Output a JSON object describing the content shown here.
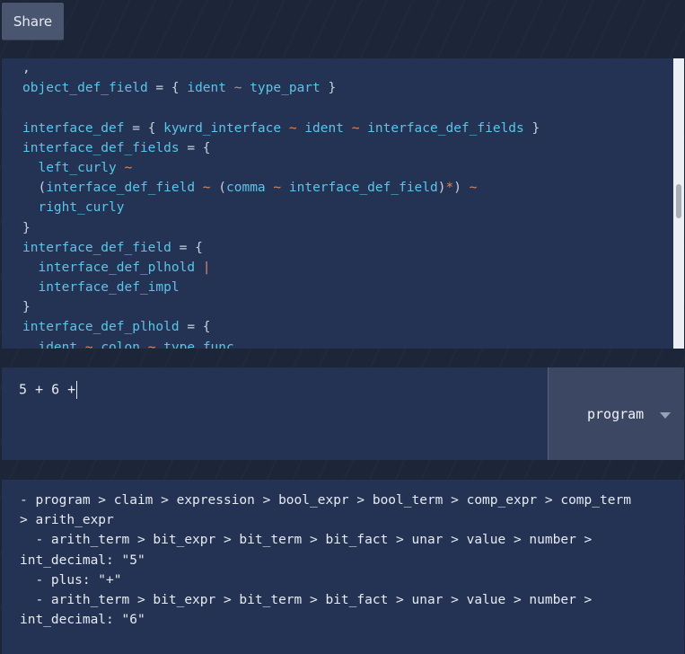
{
  "toolbar": {
    "share_label": "Share"
  },
  "editor": {
    "lines": [
      [
        {
          "t": ",",
          "c": "op"
        }
      ],
      [
        {
          "t": "object_def_field",
          "c": "id"
        },
        {
          "t": " = { ",
          "c": "op"
        },
        {
          "t": "ident",
          "c": "id"
        },
        {
          "t": " ~ ",
          "c": "op2"
        },
        {
          "t": "type_part",
          "c": "id"
        },
        {
          "t": " }",
          "c": "op"
        }
      ],
      [],
      [
        {
          "t": "interface_def",
          "c": "id"
        },
        {
          "t": " = { ",
          "c": "op"
        },
        {
          "t": "kywrd_interface",
          "c": "id"
        },
        {
          "t": " ~ ",
          "c": "op2"
        },
        {
          "t": "ident",
          "c": "id"
        },
        {
          "t": " ~ ",
          "c": "op2"
        },
        {
          "t": "interface_def_fields",
          "c": "id"
        },
        {
          "t": " }",
          "c": "op"
        }
      ],
      [
        {
          "t": "interface_def_fields",
          "c": "id"
        },
        {
          "t": " = {",
          "c": "op"
        }
      ],
      [
        {
          "t": "  left_curly",
          "c": "id"
        },
        {
          "t": " ~",
          "c": "op2"
        }
      ],
      [
        {
          "t": "  (",
          "c": "op"
        },
        {
          "t": "interface_def_field",
          "c": "id"
        },
        {
          "t": " ~ ",
          "c": "op2"
        },
        {
          "t": "(",
          "c": "op"
        },
        {
          "t": "comma",
          "c": "id"
        },
        {
          "t": " ~ ",
          "c": "op2"
        },
        {
          "t": "interface_def_field",
          "c": "id"
        },
        {
          "t": ")",
          "c": "op"
        },
        {
          "t": "*",
          "c": "op2"
        },
        {
          "t": ")",
          "c": "op"
        },
        {
          "t": " ~",
          "c": "op2"
        }
      ],
      [
        {
          "t": "  right_curly",
          "c": "id"
        }
      ],
      [
        {
          "t": "}",
          "c": "op"
        }
      ],
      [
        {
          "t": "interface_def_field",
          "c": "id"
        },
        {
          "t": " = {",
          "c": "op"
        }
      ],
      [
        {
          "t": "  interface_def_plhold",
          "c": "id"
        },
        {
          "t": " |",
          "c": "op2"
        }
      ],
      [
        {
          "t": "  interface_def_impl",
          "c": "id"
        }
      ],
      [
        {
          "t": "}",
          "c": "op"
        }
      ],
      [
        {
          "t": "interface_def_plhold",
          "c": "id"
        },
        {
          "t": " = {",
          "c": "op"
        }
      ],
      [
        {
          "t": "  ident",
          "c": "id"
        },
        {
          "t": " ~ ",
          "c": "op2"
        },
        {
          "t": "colon",
          "c": "id"
        },
        {
          "t": " ~ ",
          "c": "op2"
        },
        {
          "t": "type_func",
          "c": "id"
        }
      ]
    ]
  },
  "input": {
    "value": "5 + 6 +"
  },
  "rule_select": {
    "selected": "program"
  },
  "output": {
    "lines": [
      "- program > claim > expression > bool_expr > bool_term > comp_expr > comp_term",
      "> arith_expr",
      "  - arith_term > bit_expr > bit_term > bit_fact > unar > value > number >",
      "int_decimal: \"5\"",
      "  - plus: \"+\"",
      "  - arith_term > bit_expr > bit_term > bit_fact > unar > value > number >",
      "int_decimal: \"6\""
    ]
  },
  "icons": {
    "rule_dropdown": "chevron-down-icon"
  },
  "colors": {
    "background": "#1c2638",
    "panel": "#243353",
    "identifier": "#5cc4e8",
    "operator": "#d68a66",
    "button": "#4a5670"
  }
}
